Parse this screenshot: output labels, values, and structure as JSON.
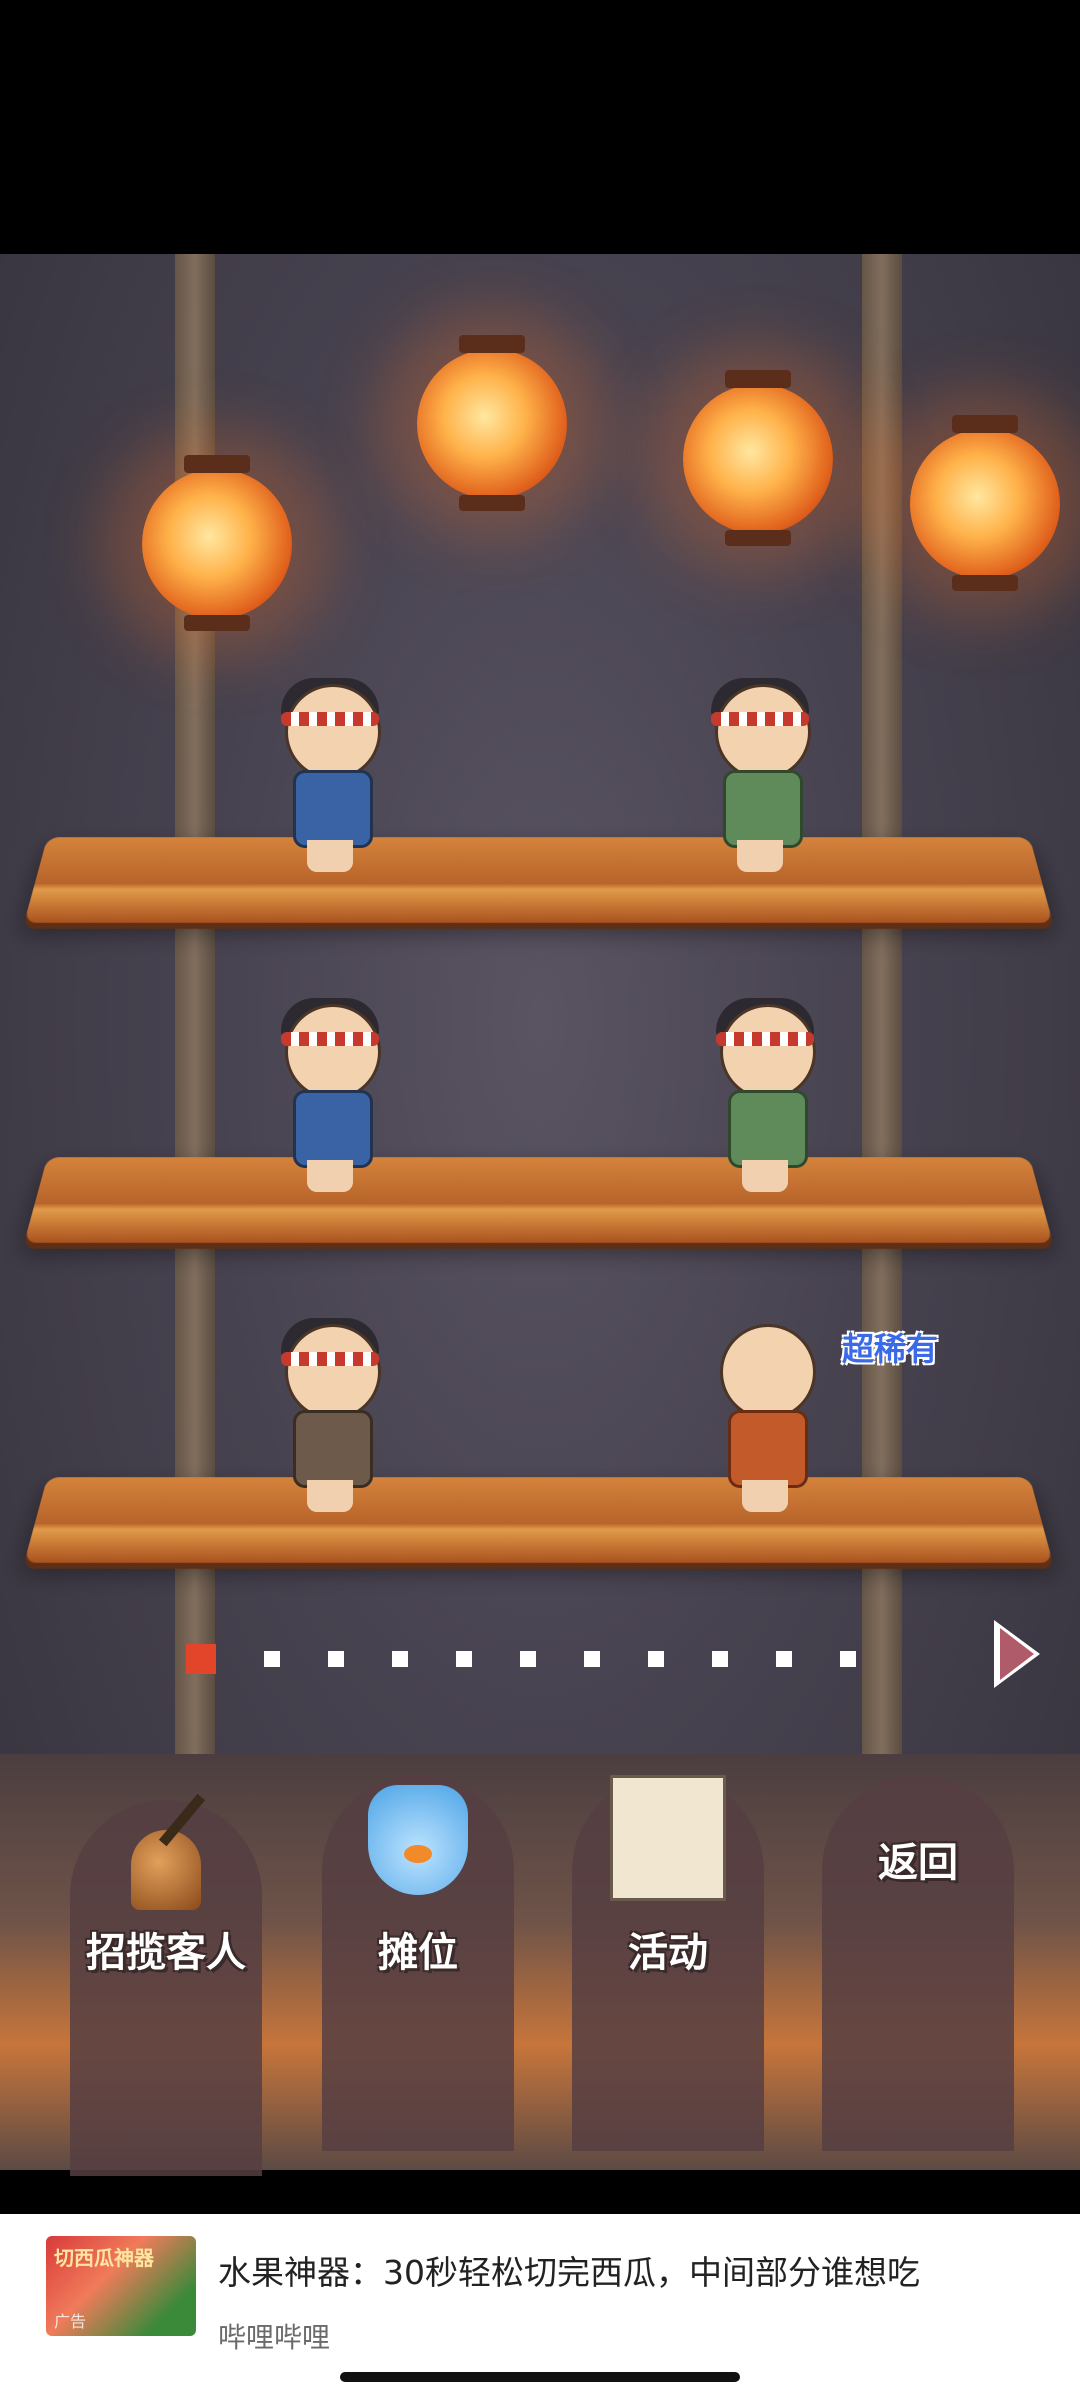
{
  "game": {
    "rare_label": "超稀有",
    "pager": {
      "total": 11,
      "current": 1
    },
    "menu": [
      {
        "label": "招揽客人",
        "icon": "bell-icon"
      },
      {
        "label": "摊位",
        "icon": "goldfish-bag-icon"
      },
      {
        "label": "活动",
        "icon": "newspaper-icon"
      },
      {
        "label": "返回",
        "icon": ""
      }
    ],
    "thumb_text": "切西瓜神器"
  },
  "ad": {
    "title": "水果神器：30秒轻松切完西瓜，中间部分谁想吃",
    "source": "哔哩哔哩",
    "tag": "广告"
  }
}
